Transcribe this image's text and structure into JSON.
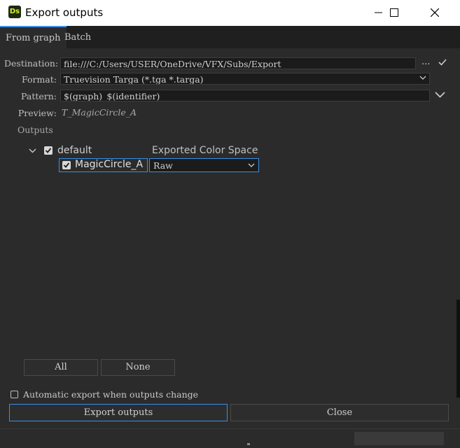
{
  "window": {
    "app_icon_text": "Ds",
    "title": "Export outputs"
  },
  "tabs": [
    {
      "label": "From graph",
      "active": true
    },
    {
      "label": "Batch",
      "active": false
    }
  ],
  "form": {
    "destination_label": "Destination:",
    "destination_value": "file:///C:/Users/USER/OneDrive/VFX/Subs/Export",
    "destination_browse": "...",
    "format_label": "Format:",
    "format_value": "Truevision Targa (*.tga *.targa)",
    "pattern_label": "Pattern:",
    "pattern_value": "$(graph)_$(identifier)",
    "preview_label": "Preview:",
    "preview_value": "T_MagicCircle_A"
  },
  "outputs": {
    "section_label": "Outputs",
    "group_name": "default",
    "group_checked": true,
    "color_space_header": "Exported Color Space",
    "items": [
      {
        "name": "MagicCircle_A",
        "checked": true,
        "color_space": "Raw"
      }
    ]
  },
  "selection_buttons": {
    "all": "All",
    "none": "None"
  },
  "options": {
    "auto_export_label": "Automatic export when outputs change",
    "auto_export_checked": false
  },
  "actions": {
    "export": "Export outputs",
    "close": "Close"
  },
  "colors": {
    "accent": "#3a8ee6",
    "background": "#2b2b2b",
    "tabbar": "#1f1f1f"
  }
}
